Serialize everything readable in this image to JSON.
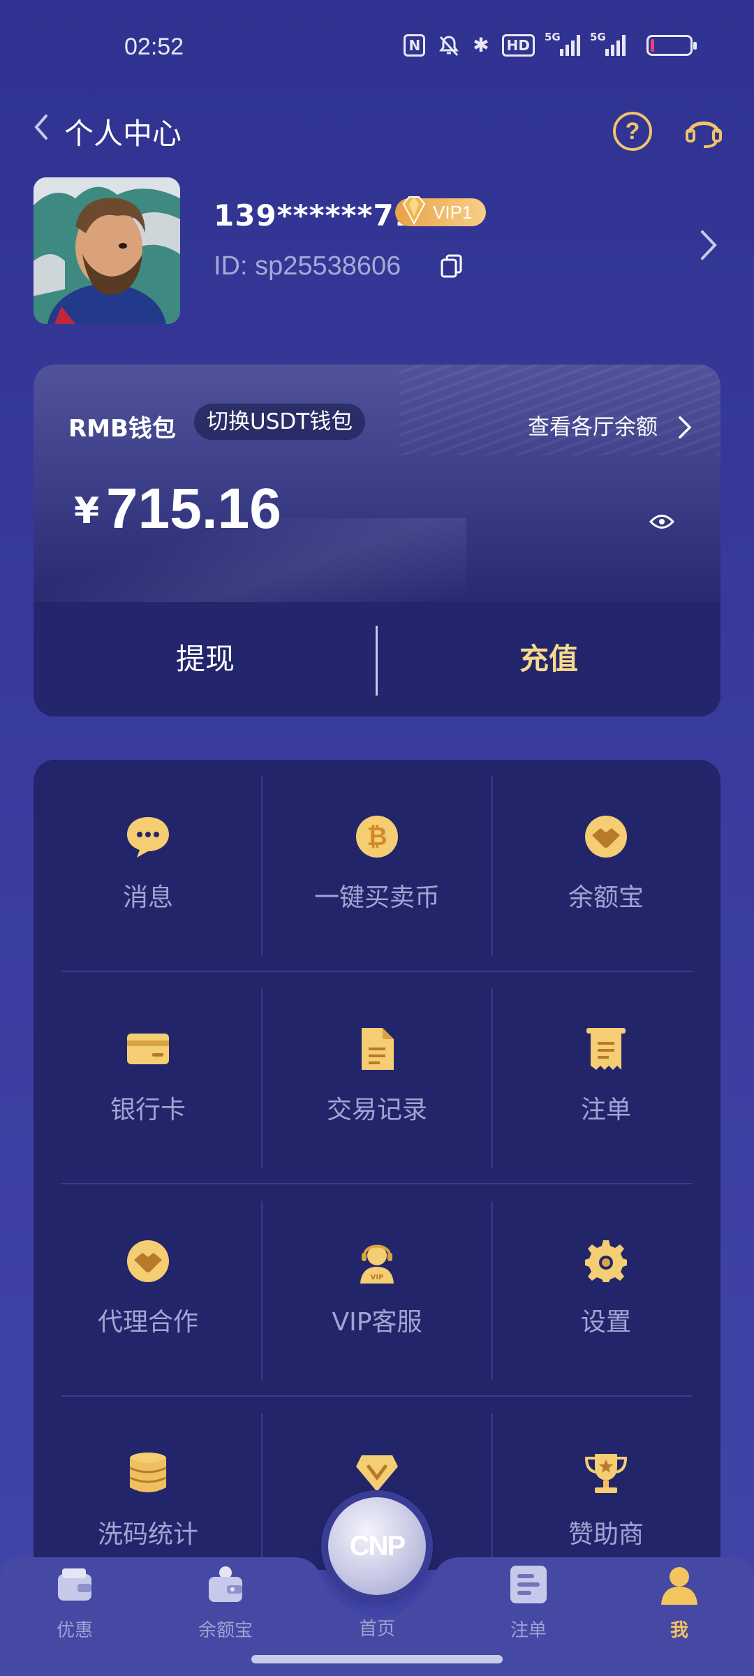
{
  "status_bar": {
    "time": "02:52",
    "nfc": "N",
    "bluetooth": "✱",
    "hd": "HD",
    "net1": "5G",
    "net2": "5G"
  },
  "header": {
    "title": "个人中心"
  },
  "profile": {
    "username": "139******71",
    "vip_level": "VIP1",
    "user_id": "ID: sp25538606"
  },
  "wallet": {
    "label": "RMB钱包",
    "switch_label": "切换USDT钱包",
    "view_balances": "查看各厅余额",
    "currency_symbol": "¥",
    "balance": "715.16",
    "withdraw": "提现",
    "deposit": "充值"
  },
  "menu": {
    "items": [
      {
        "label": "消息",
        "icon": "message-icon"
      },
      {
        "label": "一键买卖币",
        "icon": "bitcoin-icon"
      },
      {
        "label": "余额宝",
        "icon": "handshake-icon"
      },
      {
        "label": "银行卡",
        "icon": "bank-card-icon"
      },
      {
        "label": "交易记录",
        "icon": "document-icon"
      },
      {
        "label": "注单",
        "icon": "receipt-icon"
      },
      {
        "label": "代理合作",
        "icon": "handshake-icon"
      },
      {
        "label": "VIP客服",
        "icon": "vip-agent-icon"
      },
      {
        "label": "设置",
        "icon": "gear-icon"
      },
      {
        "label": "洗码统计",
        "icon": "coin-stack-icon"
      },
      {
        "label": "",
        "icon": "medal-icon"
      },
      {
        "label": "赞助商",
        "icon": "trophy-icon"
      }
    ]
  },
  "bottom_nav": {
    "promo": "优惠",
    "balance_treasure": "余额宝",
    "home": "首页",
    "home_logo": "CNP",
    "bets": "注单",
    "me": "我"
  },
  "colors": {
    "background": "#2f3290",
    "gold": "#f0c46a",
    "deposit": "#f7d98b",
    "muted_text": "#a2a4d3"
  }
}
